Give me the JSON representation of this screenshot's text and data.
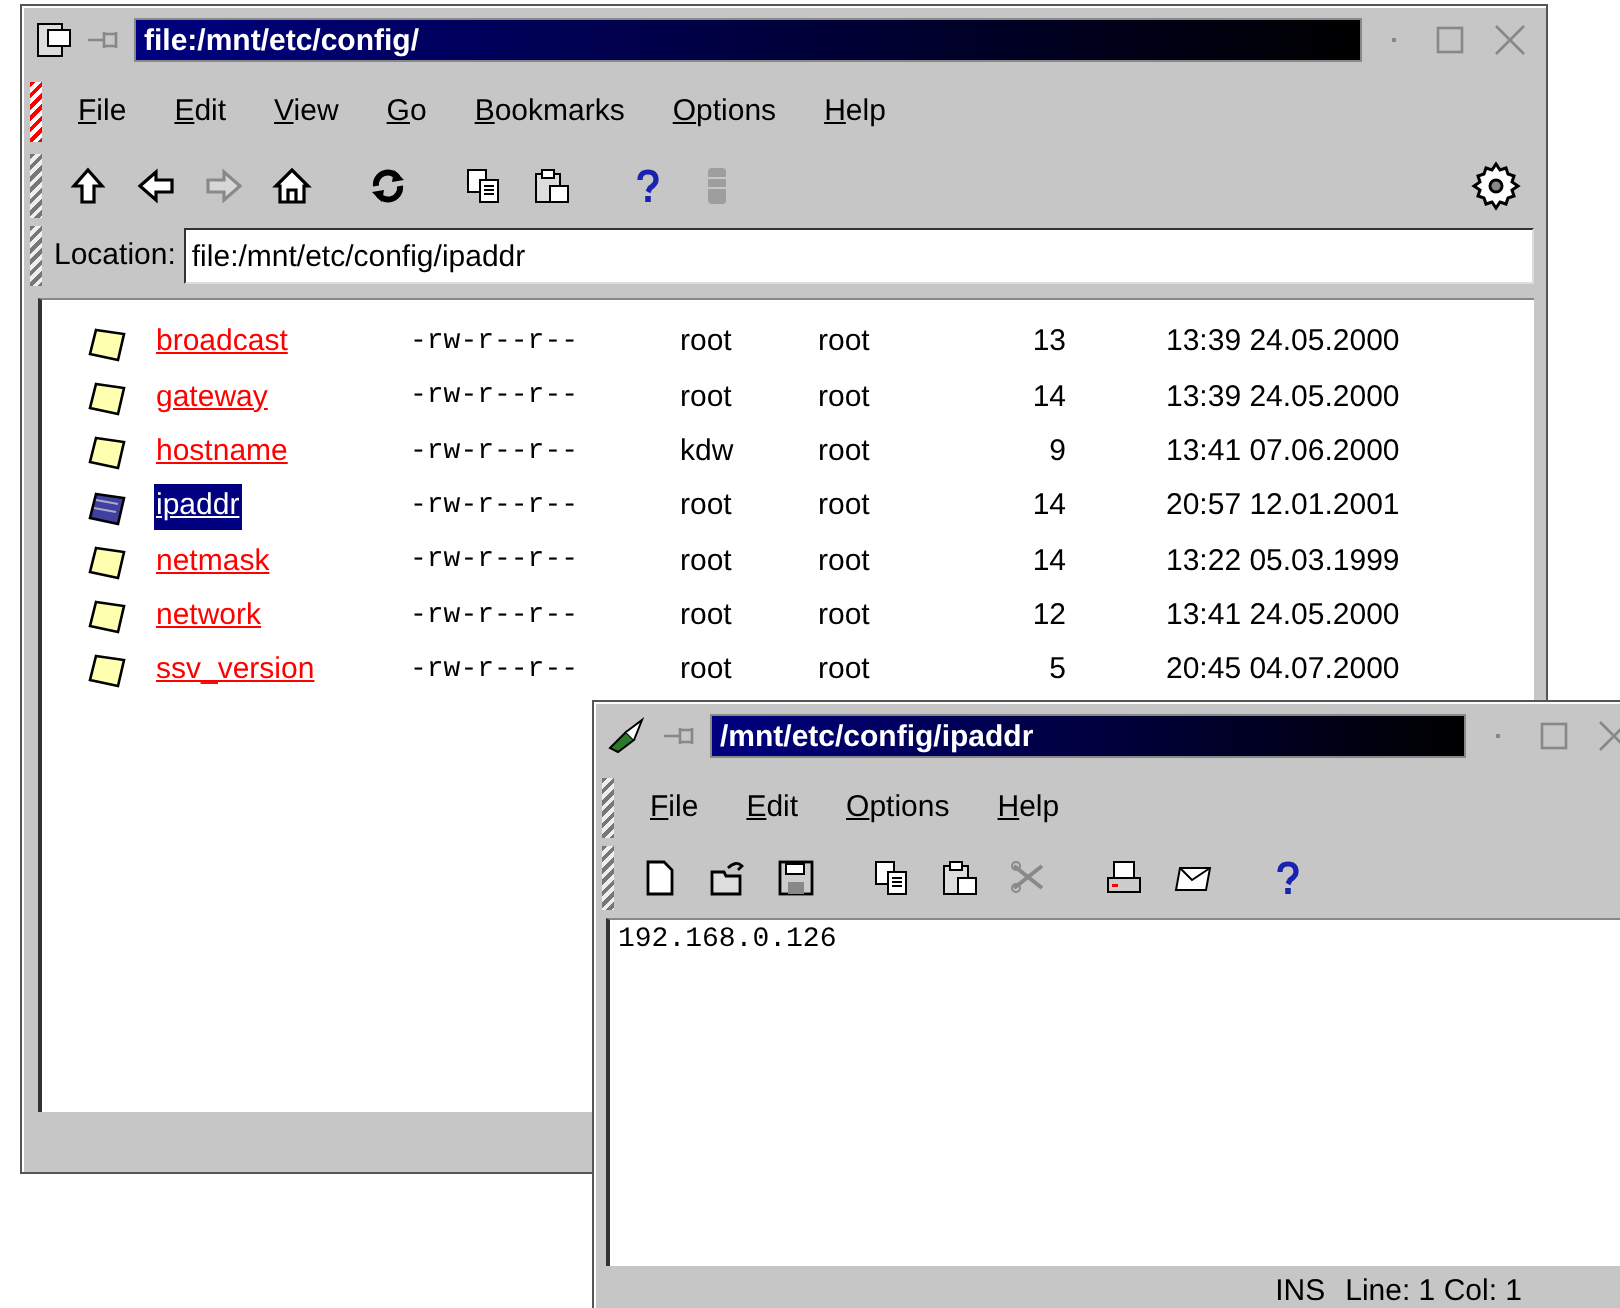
{
  "file_manager": {
    "title": "file:/mnt/etc/config/",
    "menu": [
      "File",
      "Edit",
      "View",
      "Go",
      "Bookmarks",
      "Options",
      "Help"
    ],
    "toolbar": [
      {
        "kind": "up",
        "disabled": false
      },
      {
        "kind": "back",
        "disabled": false
      },
      {
        "kind": "forward",
        "disabled": true
      },
      {
        "kind": "home",
        "disabled": false
      },
      {
        "kind": "reload",
        "disabled": false
      },
      {
        "kind": "copy",
        "disabled": false
      },
      {
        "kind": "paste",
        "disabled": false
      },
      {
        "kind": "help",
        "disabled": false
      },
      {
        "kind": "stop",
        "disabled": true
      }
    ],
    "location": {
      "label": "Location:",
      "value": "file:/mnt/etc/config/ipaddr"
    },
    "files": [
      {
        "name": "broadcast",
        "permissions": "-rw-r--r--",
        "owner": "root",
        "group": "root",
        "size": "13",
        "modified": "13:39 24.05.2000",
        "selected": false
      },
      {
        "name": "gateway",
        "permissions": "-rw-r--r--",
        "owner": "root",
        "group": "root",
        "size": "14",
        "modified": "13:39 24.05.2000",
        "selected": false
      },
      {
        "name": "hostname",
        "permissions": "-rw-r--r--",
        "owner": "kdw",
        "group": "root",
        "size": "9",
        "modified": "13:41 07.06.2000",
        "selected": false
      },
      {
        "name": "ipaddr",
        "permissions": "-rw-r--r--",
        "owner": "root",
        "group": "root",
        "size": "14",
        "modified": "20:57 12.01.2001",
        "selected": true
      },
      {
        "name": "netmask",
        "permissions": "-rw-r--r--",
        "owner": "root",
        "group": "root",
        "size": "14",
        "modified": "13:22 05.03.1999",
        "selected": false
      },
      {
        "name": "network",
        "permissions": "-rw-r--r--",
        "owner": "root",
        "group": "root",
        "size": "12",
        "modified": "13:41 24.05.2000",
        "selected": false
      },
      {
        "name": "ssv_version",
        "permissions": "-rw-r--r--",
        "owner": "root",
        "group": "root",
        "size": "5",
        "modified": "20:45 04.07.2000",
        "selected": false
      }
    ]
  },
  "editor": {
    "title": "/mnt/etc/config/ipaddr",
    "menu": [
      "File",
      "Edit",
      "Options",
      "Help"
    ],
    "toolbar": [
      {
        "kind": "new",
        "disabled": false
      },
      {
        "kind": "open",
        "disabled": false
      },
      {
        "kind": "save",
        "disabled": false
      },
      {
        "kind": "copy",
        "disabled": false
      },
      {
        "kind": "paste",
        "disabled": false
      },
      {
        "kind": "cut",
        "disabled": true
      },
      {
        "kind": "print",
        "disabled": false
      },
      {
        "kind": "mail",
        "disabled": false
      },
      {
        "kind": "help",
        "disabled": false
      }
    ],
    "content": "192.168.0.126",
    "status_bar": [
      "INS",
      "Line: 1 Col: 1"
    ]
  }
}
